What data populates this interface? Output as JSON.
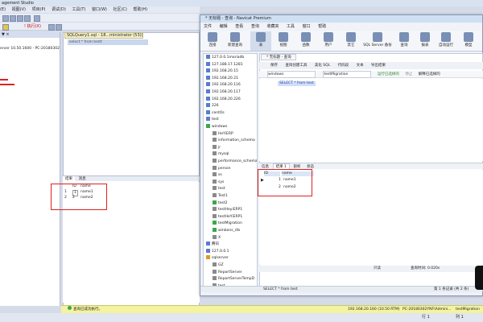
{
  "ssms": {
    "title": "agement Studio",
    "menu": [
      "(E)",
      "视图(V)",
      "项目(P)",
      "调试(D)",
      "工具(T)",
      "窗口(W)",
      "社区(C)",
      "帮助(H)"
    ],
    "execute_label": "! 执行(X)",
    "query_tab": "SQLQuery1.sql - 18...ministrator (53))*",
    "query_text": "select * from testt",
    "server_text": "erver 10.50.1600 - PC-20180302",
    "result_tabs": [
      "结果",
      "消息"
    ],
    "grid_headers": [
      "ID",
      "name"
    ],
    "grid_rows": [
      {
        "rownum": "1",
        "id": "1",
        "name": "name1"
      },
      {
        "rownum": "2",
        "id": "2",
        "name": "name2"
      }
    ],
    "status_message": "查询已成功执行。",
    "status_server": "192.168.20.160 (10.50 RTM)",
    "status_machine": "PC-20180302YNF\\Admini...",
    "status_db": "testMigration",
    "status_row": "行 1",
    "status_col": "列 1"
  },
  "navicat": {
    "title": "* 无标题 - 查询 - Navicat Premium",
    "menu": [
      "文件",
      "编辑",
      "查看",
      "查询",
      "收藏夹",
      "工具",
      "窗口",
      "帮助"
    ],
    "ribbon": [
      {
        "label": "连接",
        "icon": "connect-icon"
      },
      {
        "label": "新建查询",
        "icon": "new-query-icon"
      },
      {
        "label": "表",
        "icon": "table-icon"
      },
      {
        "label": "视图",
        "icon": "view-icon"
      },
      {
        "label": "函数",
        "icon": "function-icon"
      },
      {
        "label": "用户",
        "icon": "user-icon"
      },
      {
        "label": "其它",
        "icon": "other-icon"
      },
      {
        "label": "SQL Server 备份",
        "icon": "backup-icon"
      },
      {
        "label": "查询",
        "icon": "query-icon"
      },
      {
        "label": "报表",
        "icon": "report-icon"
      },
      {
        "label": "自动运行",
        "icon": "schedule-icon"
      },
      {
        "label": "模型",
        "icon": "model-icon"
      }
    ],
    "tree": [
      {
        "label": "127.0.0.1mariadb",
        "level": 0,
        "color": "#5a7bd1"
      },
      {
        "label": "127.188.17.1281",
        "level": 0,
        "color": "#5a7bd1"
      },
      {
        "label": "192.168.20.15",
        "level": 0,
        "color": "#5a7bd1"
      },
      {
        "label": "192.168.20.21",
        "level": 0,
        "color": "#5a7bd1"
      },
      {
        "label": "192.168.20.116",
        "level": 0,
        "color": "#5a7bd1"
      },
      {
        "label": "192.168.20.117",
        "level": 0,
        "color": "#5a7bd1"
      },
      {
        "label": "192.168.20.226",
        "level": 0,
        "color": "#5a7bd1"
      },
      {
        "label": "226",
        "level": 0,
        "color": "#5a7bd1"
      },
      {
        "label": "centOs",
        "level": 0,
        "color": "#5a7bd1"
      },
      {
        "label": "test",
        "level": 0,
        "color": "#5a7bd1"
      },
      {
        "label": "windows",
        "level": 0,
        "color": "#3aa84a"
      },
      {
        "label": "HeYiERP",
        "level": 1,
        "color": "#8a8a8a"
      },
      {
        "label": "information_schema",
        "level": 1,
        "color": "#8a8a8a"
      },
      {
        "label": "jr",
        "level": 1,
        "color": "#8a8a8a"
      },
      {
        "label": "mysql",
        "level": 1,
        "color": "#8a8a8a"
      },
      {
        "label": "performance_schema",
        "level": 1,
        "color": "#8a8a8a"
      },
      {
        "label": "person",
        "level": 1,
        "color": "#8a8a8a"
      },
      {
        "label": "ss",
        "level": 1,
        "color": "#8a8a8a"
      },
      {
        "label": "sys",
        "level": 1,
        "color": "#8a8a8a"
      },
      {
        "label": "test",
        "level": 1,
        "color": "#8a8a8a"
      },
      {
        "label": "Test1",
        "level": 1,
        "color": "#8a8a8a"
      },
      {
        "label": "test2",
        "level": 1,
        "color": "#3aa84a"
      },
      {
        "label": "testHeyiERP1",
        "level": 1,
        "color": "#8a8a8a"
      },
      {
        "label": "testHeYiERP1",
        "level": 1,
        "color": "#8a8a8a"
      },
      {
        "label": "testMigration",
        "level": 1,
        "color": "#3aa84a"
      },
      {
        "label": "winbons_dls",
        "level": 1,
        "color": "#3aa84a"
      },
      {
        "label": "X",
        "level": 1,
        "color": "#8a8a8a"
      },
      {
        "label": "腾讯",
        "level": 0,
        "color": "#5a7bd1"
      },
      {
        "label": "127.0.0.1",
        "level": 0,
        "color": "#5a7bd1"
      },
      {
        "label": "sqlserver",
        "level": 0,
        "color": "#e0972a"
      },
      {
        "label": "GZ",
        "level": 1,
        "color": "#8a8a8a"
      },
      {
        "label": "ReportServer",
        "level": 1,
        "color": "#8a8a8a"
      },
      {
        "label": "ReportServerTempD",
        "level": 1,
        "color": "#8a8a8a"
      },
      {
        "label": "test",
        "level": 1,
        "color": "#8a8a8a"
      }
    ],
    "editor_tab": "* 无标题 - 查询",
    "toolbar_items": [
      "保存",
      "查询创建工具",
      "美化 SQL",
      "代码段",
      "文本",
      "导出结果"
    ],
    "db_select": "windows",
    "schema_select": "testMigration",
    "run_label": "运行已选择的",
    "stop_label": "停止",
    "explain_label": "解释已选择的",
    "sql_text": "SELECT * from test",
    "result_tabs": [
      "信息",
      "结果 1",
      "剖析",
      "状态"
    ],
    "grid_headers": [
      "ID",
      "name"
    ],
    "grid_rows": [
      {
        "id": "1",
        "name": "name1"
      },
      {
        "id": "2",
        "name": "name2"
      }
    ],
    "status_readonly": "只读",
    "status_time": "查询时间: 0.020s",
    "status_record": "第 1 条记录 (共 2 条)",
    "status_sql": "SELECT * from test"
  },
  "colors": {
    "annotation_red": "#e02020",
    "status_yellow": "#f3f3a0"
  }
}
